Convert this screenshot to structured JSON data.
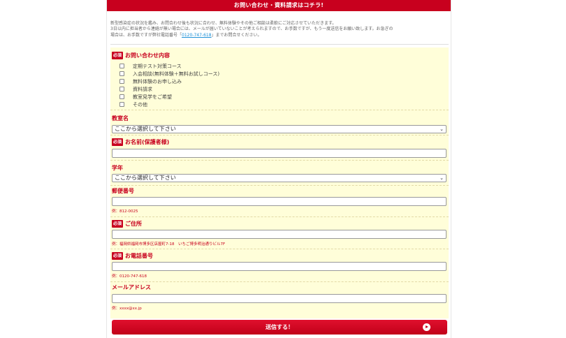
{
  "header": {
    "title": "お問い合わせ・資料請求はコチラ!"
  },
  "intro": {
    "line1": "新型感染症の状況を鑑み、お問合わせ後も状況に合わせ、無料体験やその他ご相談は柔軟にご対応させていただきます。",
    "line2": "3日以内に担当者から連絡が無い場合には、メールが届いていないことが考えられますので、お手数ですが、もう一度送信をお願い致します。お急ぎの",
    "line3_pre": "場合は、お手数ですが弊社電話番号「",
    "phone": "0120-747-618",
    "line3_post": "」までお問合せください。"
  },
  "form": {
    "required_badge": "必須",
    "inquiry": {
      "label": "お問い合わせ内容",
      "options": [
        "定期テスト対策コース",
        "入会相談(無料体験＋無料お試しコース)",
        "無料体験のお申し込み",
        "資料請求",
        "教室見学をご希望",
        "その他"
      ]
    },
    "classroom": {
      "label": "教室名",
      "selected": "ここから選択して下さい"
    },
    "name": {
      "label": "お名前(保護者様)"
    },
    "grade": {
      "label": "学年",
      "selected": "ここから選択して下さい"
    },
    "zip": {
      "label": "郵便番号",
      "example": "例：812-0025"
    },
    "address": {
      "label": "ご住所",
      "example": "例：福岡県福岡市博多区店屋町7-18　いちご博多明治通りビル7F"
    },
    "tel": {
      "label": "お電話番号",
      "example": "例：0120-747-618"
    },
    "email": {
      "label": "メールアドレス",
      "example": "例：xxxx@xx.jp"
    },
    "submit_label": "送信する！"
  },
  "colors": {
    "accent": "#c8001e",
    "form_background": "#fffed9",
    "link": "#1a8fd6"
  }
}
